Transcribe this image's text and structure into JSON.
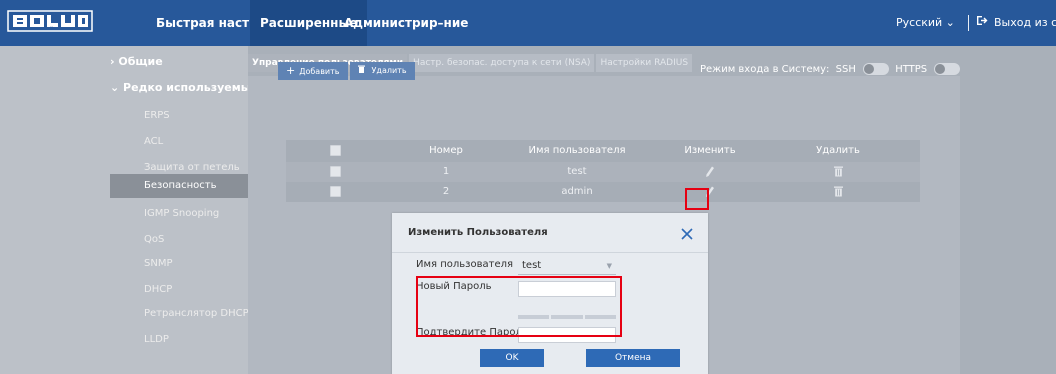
{
  "header": {
    "logo_text": "BOLID",
    "nav": [
      {
        "label": "Быстрая настройка"
      },
      {
        "label": "Расширенные"
      },
      {
        "label": "Администрир–ние"
      }
    ],
    "language": "Русский ⌄",
    "logout": "Выход из системы"
  },
  "sidebar": {
    "groups": [
      {
        "label": "› Общие"
      },
      {
        "label": "⌄ Редко используемые"
      }
    ],
    "items": [
      {
        "label": "ERPS"
      },
      {
        "label": "ACL"
      },
      {
        "label": "Защита от петель"
      },
      {
        "label": "Безопасность"
      },
      {
        "label": "IGMP Snooping"
      },
      {
        "label": "QoS"
      },
      {
        "label": "SNMP"
      },
      {
        "label": "DHCP"
      },
      {
        "label": "Ретранслятор DHCP"
      },
      {
        "label": "LLDP"
      }
    ]
  },
  "tabs": [
    {
      "label": "Управление пользователями"
    },
    {
      "label": "Настр. безопас. доступа к сети (NSA)"
    },
    {
      "label": "Настройки RADIUS"
    }
  ],
  "toolbar": {
    "add": "Добавить",
    "delete": "Удалить"
  },
  "login_mode": {
    "label": "Режим входа в Систему:",
    "ssh": "SSH",
    "https": "HTTPS"
  },
  "table": {
    "headers": [
      "Номер",
      "Имя пользователя",
      "Изменить",
      "Удалить"
    ],
    "rows": [
      {
        "num": "1",
        "user": "test"
      },
      {
        "num": "2",
        "user": "admin"
      }
    ]
  },
  "modal": {
    "title": "Изменить Пользователя",
    "username_label": "Имя пользователя",
    "username_value": "test",
    "new_password_label": "Новый Пароль",
    "confirm_password_label": "Подтвердите Пароль",
    "ok": "OK",
    "cancel": "Отмена"
  },
  "colors": {
    "header": "#27589a",
    "highlight": "#e60012",
    "primary_button": "#2e6ab6"
  }
}
